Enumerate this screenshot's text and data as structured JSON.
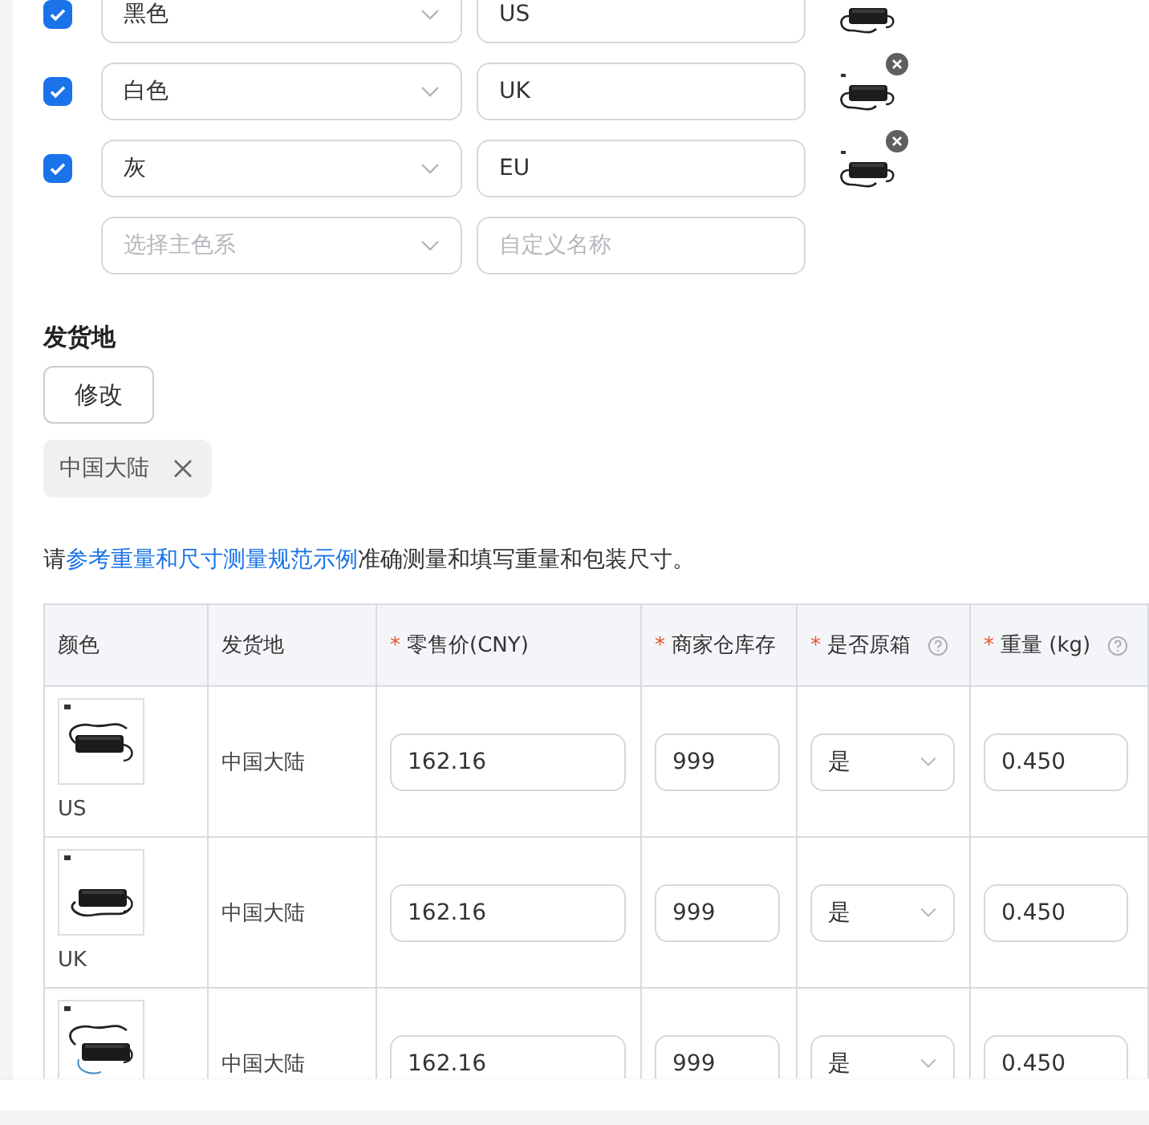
{
  "color_variants": [
    {
      "checked": true,
      "color_family": "黑色",
      "name": "US",
      "image": {
        "kind": "picture"
      }
    },
    {
      "checked": true,
      "color_family": "白色",
      "name": "UK",
      "image": {
        "kind": "picture",
        "removable": true
      }
    },
    {
      "checked": true,
      "color_family": "灰",
      "name": "EU",
      "image": {
        "kind": "picture",
        "removable": true
      }
    }
  ],
  "new_variant": {
    "color_placeholder": "选择主色系",
    "name_placeholder": "自定义名称"
  },
  "shipping": {
    "title": "发货地",
    "button": "修改",
    "tags": [
      {
        "label": "中国大陆",
        "removable": true
      }
    ]
  },
  "notice": {
    "before": "请",
    "link": "参考重量和尺寸测量规范示例",
    "after": "准确测量和填写重量和包装尺寸。"
  },
  "table": {
    "columns": [
      {
        "label": "颜色",
        "help": false
      },
      {
        "label": "发货地",
        "help": false
      },
      {
        "required_mark": "*",
        "label": "零售价(CNY)",
        "help": false
      },
      {
        "required_mark": "*",
        "label": "商家仓库存",
        "help": false
      },
      {
        "required_mark": "*",
        "label": "是否原箱",
        "help": true
      },
      {
        "required_mark": "*",
        "label": "重量 (kg)",
        "help": true
      }
    ],
    "rows": [
      {
        "color_label": "US",
        "origin": "中国大陆",
        "price": "162.16",
        "stock": "999",
        "original_box": "是",
        "weight": "0.450"
      },
      {
        "color_label": "UK",
        "origin": "中国大陆",
        "price": "162.16",
        "stock": "999",
        "original_box": "是",
        "weight": "0.450"
      },
      {
        "origin": "中国大陆",
        "price": "162.16",
        "stock": "999",
        "original_box": "是",
        "weight": "0.450"
      }
    ]
  }
}
